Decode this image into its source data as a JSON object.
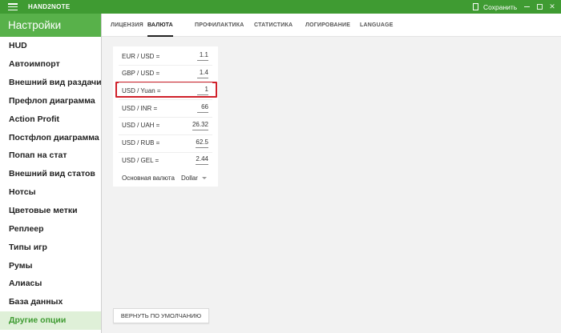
{
  "titlebar": {
    "app_name": "HAND2NOTE",
    "save_label": "Сохранить",
    "menu_icon": "hamburger-icon",
    "save_icon": "document-icon"
  },
  "sidebar": {
    "title": "Настройки",
    "items": [
      {
        "label": "HUD"
      },
      {
        "label": "Автоимпорт"
      },
      {
        "label": "Внешний вид раздачи"
      },
      {
        "label": "Префлоп диаграмма"
      },
      {
        "label": "Action Profit"
      },
      {
        "label": "Постфлоп диаграмма"
      },
      {
        "label": "Попап на стат"
      },
      {
        "label": "Внешний вид статов"
      },
      {
        "label": "Нотсы"
      },
      {
        "label": "Цветовые метки"
      },
      {
        "label": "Реплеер"
      },
      {
        "label": "Типы игр"
      },
      {
        "label": "Румы"
      },
      {
        "label": "Алиасы"
      },
      {
        "label": "База данных"
      },
      {
        "label": "Другие опции"
      }
    ],
    "active_index": 15
  },
  "tabs": [
    {
      "label": "ЛИЦЕНЗИЯ"
    },
    {
      "label": "ВАЛЮТА"
    },
    {
      "label": "ПРОФИЛАКТИКА"
    },
    {
      "label": "СТАТИСТИКА"
    },
    {
      "label": "ЛОГИРОВАНИЕ"
    },
    {
      "label": "LANGUAGE"
    }
  ],
  "active_tab_index": 1,
  "currency": {
    "rates": [
      {
        "label": "EUR / USD =",
        "value": "1.1"
      },
      {
        "label": "GBP / USD =",
        "value": "1.4"
      },
      {
        "label": "USD / Yuan =",
        "value": "1"
      },
      {
        "label": "USD / INR =",
        "value": "66"
      },
      {
        "label": "USD / UAH =",
        "value": "26.32"
      },
      {
        "label": "USD / RUB =",
        "value": "62.5"
      },
      {
        "label": "USD / GEL =",
        "value": "2.44"
      }
    ],
    "highlighted_index": 2,
    "base_label": "Основная валюта",
    "base_value": "Dollar"
  },
  "reset_label": "ВЕРНУТЬ ПО УМОЛЧАНИЮ",
  "colors": {
    "titlebar": "#3f9b32",
    "sidebar_header": "#58b14a",
    "active_item_bg": "#dff0d8",
    "highlight": "#d0202a"
  }
}
